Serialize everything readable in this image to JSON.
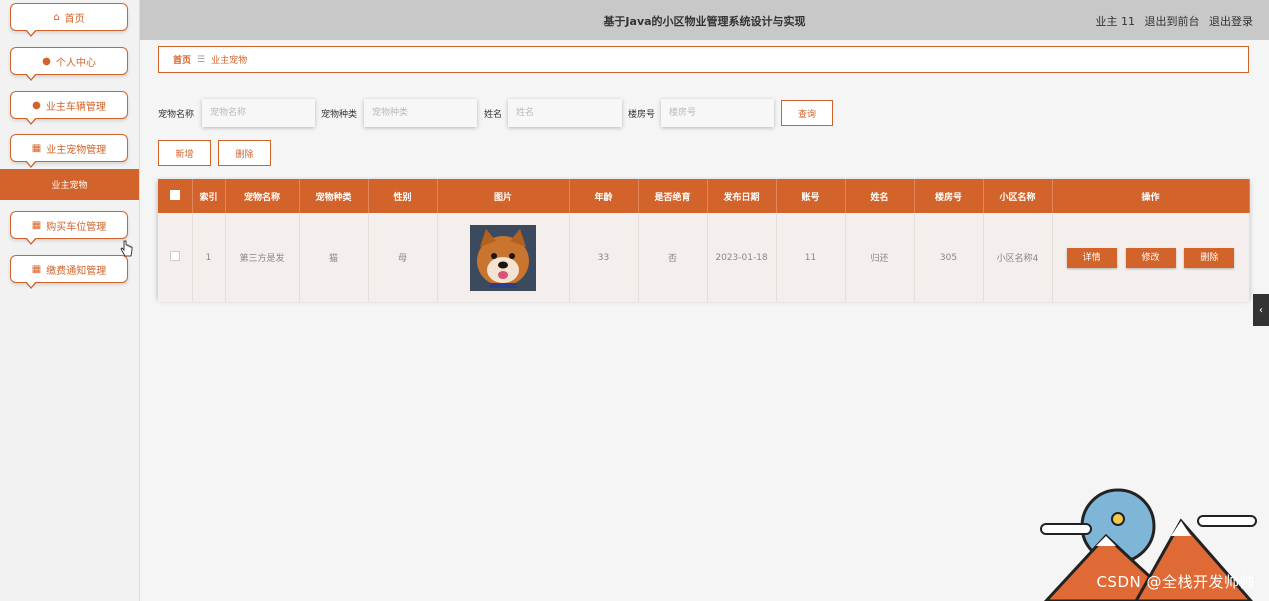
{
  "header": {
    "title": "基于Java的小区物业管理系统设计与实现",
    "user": "业主 11",
    "to_front": "退出到前台",
    "logout": "退出登录"
  },
  "sidebar": {
    "items": [
      {
        "label": "首页",
        "icon": "home-icon"
      },
      {
        "label": "个人中心",
        "icon": "user-icon"
      },
      {
        "label": "业主车辆管理",
        "icon": "user-icon"
      },
      {
        "label": "业主宠物管理",
        "icon": "grid-icon"
      },
      {
        "label": "购买车位管理",
        "icon": "grid-icon"
      },
      {
        "label": "缴费通知管理",
        "icon": "grid-icon"
      }
    ],
    "active_sub": "业主宠物"
  },
  "breadcrumb": {
    "home": "首页",
    "sep": "☰",
    "current": "业主宠物"
  },
  "search": {
    "pet_name_label": "宠物名称",
    "pet_name_placeholder": "宠物名称",
    "pet_type_label": "宠物种类",
    "pet_type_placeholder": "宠物种类",
    "name_label": "姓名",
    "name_placeholder": "姓名",
    "building_label": "楼房号",
    "building_placeholder": "楼房号",
    "query_label": "查询"
  },
  "actions": {
    "add_label": "新增",
    "delete_label": "删除"
  },
  "table": {
    "headers": [
      "索引",
      "宠物名称",
      "宠物种类",
      "性别",
      "图片",
      "年龄",
      "是否绝育",
      "发布日期",
      "账号",
      "姓名",
      "楼房号",
      "小区名称",
      "操作"
    ],
    "rows": [
      {
        "index": "1",
        "pet_name": "第三方是发",
        "pet_type": "猫",
        "gender": "母",
        "age": "33",
        "neutered": "否",
        "date": "2023-01-18",
        "account": "11",
        "name": "归还",
        "building": "305",
        "community": "小区名称4"
      }
    ],
    "row_ops": {
      "detail": "详情",
      "edit": "修改",
      "delete": "删除"
    }
  },
  "watermark": "CSDN @全栈开发帅帅",
  "colors": {
    "accent": "#d2632a",
    "header_bg": "#c8c8c8"
  }
}
